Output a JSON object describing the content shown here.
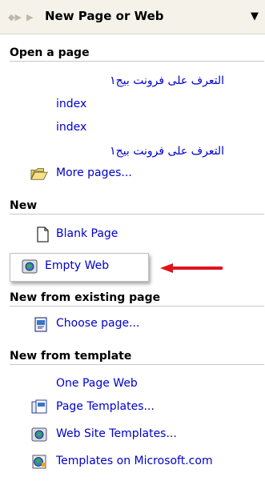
{
  "header": {
    "title": "New Page or Web"
  },
  "open_a_page": {
    "heading": "Open a page",
    "items": [
      "التعرف على فرونت بيج١",
      "index",
      "index",
      "التعرف على فرونت بيج١"
    ],
    "more": "More pages..."
  },
  "new": {
    "heading": "New",
    "blank_page": "Blank Page",
    "empty_web": "Empty Web"
  },
  "new_from_existing": {
    "heading": "New from existing page",
    "choose": "Choose page..."
  },
  "new_from_template": {
    "heading": "New from template",
    "one_page_web": "One Page Web",
    "page_templates": "Page Templates...",
    "web_site_templates": "Web Site Templates...",
    "templates_online": "Templates on Microsoft.com"
  },
  "colors": {
    "link": "#0000cc",
    "arrow": "#e0141e",
    "header_bg": "#f4f2e9"
  }
}
